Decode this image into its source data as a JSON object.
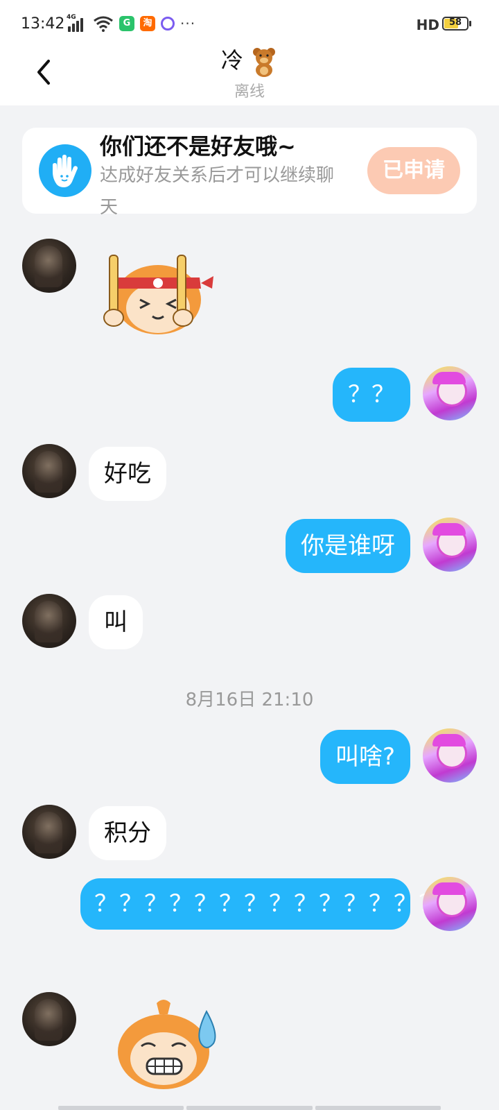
{
  "status_bar": {
    "time": "13:42",
    "network": "4G",
    "app_icons": [
      {
        "label": "G",
        "color": "#2bc36b"
      },
      {
        "label": "淘",
        "color": "#ff6a00"
      },
      {
        "label": "",
        "color": "#7b5cf0"
      }
    ],
    "more": "···",
    "hd": "HD",
    "battery": "58",
    "battery_level": 0.58
  },
  "header": {
    "title": "冷",
    "title_emoji": "🧸",
    "subtitle": "离线"
  },
  "banner": {
    "title": "你们还不是好友哦~",
    "description": "达成好友关系后才可以继续聊天",
    "button_label": "已申请",
    "button_color": "#fccab3",
    "icon": "hand-icon"
  },
  "messages": [
    {
      "from": "other",
      "type": "sticker",
      "sticker": "headband-cat-sticker"
    },
    {
      "from": "me",
      "type": "text",
      "text": "？？"
    },
    {
      "from": "other",
      "type": "text",
      "text": "好吃"
    },
    {
      "from": "me",
      "type": "text",
      "text": "你是谁呀"
    },
    {
      "from": "other",
      "type": "text",
      "text": "叫"
    },
    {
      "type": "timestamp",
      "text": "8月16日 21:10"
    },
    {
      "from": "me",
      "type": "text",
      "text": "叫啥?"
    },
    {
      "from": "other",
      "type": "text",
      "text": "积分"
    },
    {
      "from": "me",
      "type": "text",
      "text": "？？？？？？？？？？？？？？？"
    },
    {
      "from": "other",
      "type": "sticker",
      "sticker": "sweating-cat-sticker"
    }
  ],
  "colors": {
    "outgoing_bubble": "#25b6fb",
    "incoming_bubble": "#ffffff",
    "background": "#f2f3f5"
  }
}
